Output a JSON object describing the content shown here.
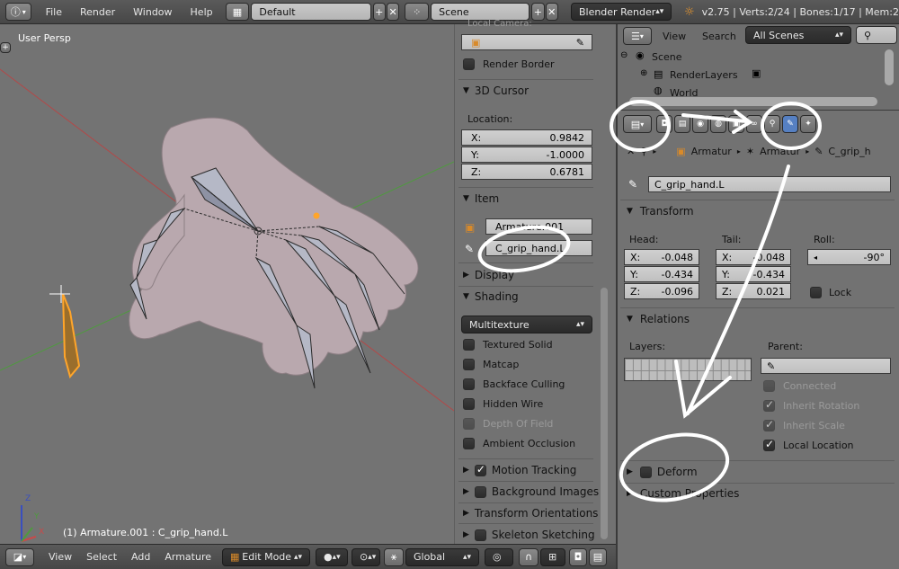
{
  "topbar": {
    "menus": [
      "File",
      "Render",
      "Window",
      "Help"
    ],
    "layout": "Default",
    "scene": "Scene",
    "engine": "Blender Render",
    "stats": "v2.75 | Verts:2/24 | Bones:1/17 | Mem:2"
  },
  "viewport": {
    "title": "User Persp",
    "status": "(1) Armature.001 : C_grip_hand.L",
    "axis_x": "X",
    "axis_y": "Y",
    "axis_z": "Z"
  },
  "npanel": {
    "local_camera": "Local Camera:",
    "render_border": "Render Border",
    "cursor_title": "3D Cursor",
    "location_label": "Location:",
    "cursor": [
      {
        "axis": "X:",
        "value": "0.9842"
      },
      {
        "axis": "Y:",
        "value": "-1.0000"
      },
      {
        "axis": "Z:",
        "value": "0.6781"
      }
    ],
    "item_title": "Item",
    "item_object": "Armature.001",
    "item_bone": "C_grip_hand.L",
    "display_title": "Display",
    "shading_title": "Shading",
    "shading_mode": "Multitexture",
    "shading_options": [
      {
        "label": "Textured Solid",
        "checked": false,
        "disabled": false
      },
      {
        "label": "Matcap",
        "checked": false,
        "disabled": false
      },
      {
        "label": "Backface Culling",
        "checked": false,
        "disabled": false
      },
      {
        "label": "Hidden Wire",
        "checked": false,
        "disabled": false
      },
      {
        "label": "Depth Of Field",
        "checked": false,
        "disabled": true
      },
      {
        "label": "Ambient Occlusion",
        "checked": false,
        "disabled": false
      }
    ],
    "motion_tracking": "Motion Tracking",
    "background_images": "Background Images",
    "transform_orientations": "Transform Orientations",
    "skeleton_sketching": "Skeleton Sketching"
  },
  "outliner": {
    "menus": [
      "View",
      "Search"
    ],
    "filter": "All Scenes",
    "tree": [
      "Scene",
      "RenderLayers",
      "World"
    ]
  },
  "properties": {
    "breadcrumb": [
      "Armatur",
      "Armatur",
      "C_grip_h"
    ],
    "bone_name": "C_grip_hand.L",
    "transform_title": "Transform",
    "head_label": "Head:",
    "tail_label": "Tail:",
    "roll_label": "Roll:",
    "head": [
      {
        "axis": "X:",
        "value": "-0.048"
      },
      {
        "axis": "Y:",
        "value": "-0.434"
      },
      {
        "axis": "Z:",
        "value": "-0.096"
      }
    ],
    "tail": [
      {
        "axis": "X:",
        "value": "-0.048"
      },
      {
        "axis": "Y:",
        "value": "-0.434"
      },
      {
        "axis": "Z:",
        "value": "0.021"
      }
    ],
    "roll": "-90°",
    "lock": "Lock",
    "relations_title": "Relations",
    "layers_label": "Layers:",
    "parent_label": "Parent:",
    "connected": "Connected",
    "inherit_rotation": "Inherit Rotation",
    "inherit_scale": "Inherit Scale",
    "local_location": "Local Location",
    "deform_title": "Deform",
    "custom_properties": "Custom Properties"
  },
  "bottombar": {
    "menus": [
      "View",
      "Select",
      "Add",
      "Armature"
    ],
    "mode": "Edit Mode",
    "orientation": "Global"
  },
  "colors": {
    "x_axis": "#c84a4a",
    "y_axis": "#5fa64c",
    "selected": "#ffa52a",
    "active_tab": "#5680c2"
  }
}
